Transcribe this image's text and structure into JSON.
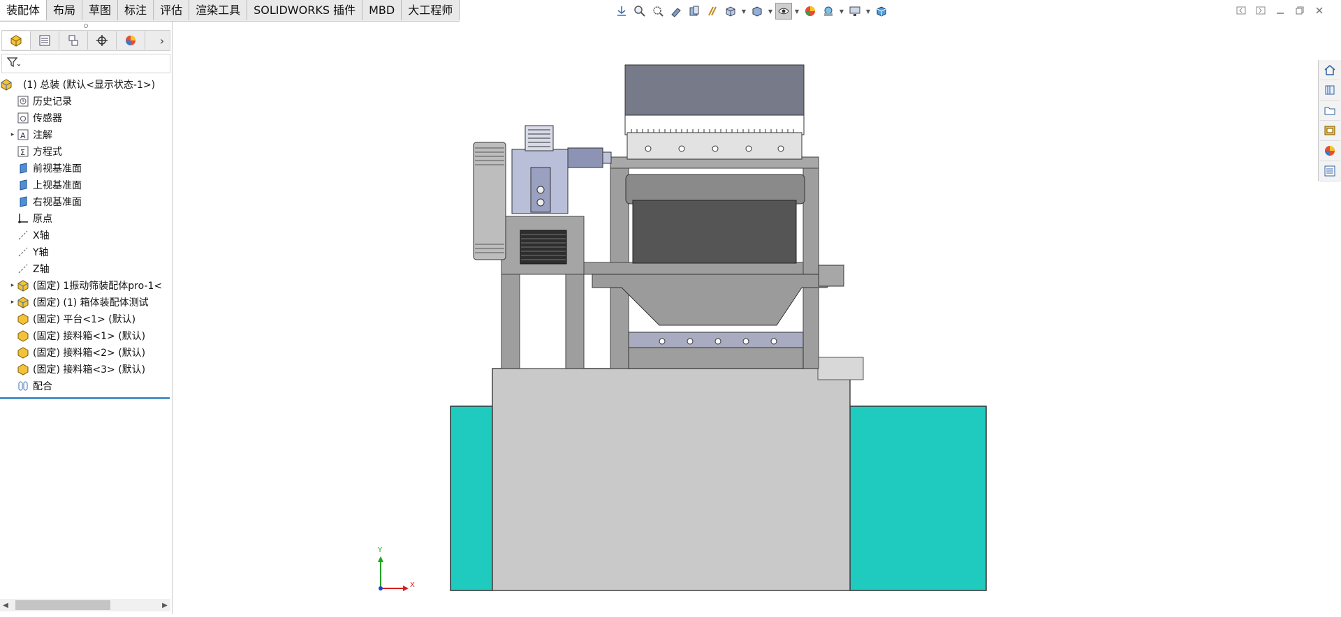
{
  "command_tabs": [
    {
      "label": "装配体",
      "active": true
    },
    {
      "label": "布局"
    },
    {
      "label": "草图"
    },
    {
      "label": "标注"
    },
    {
      "label": "评估"
    },
    {
      "label": "渲染工具"
    },
    {
      "label": "SOLIDWORKS 插件"
    },
    {
      "label": "MBD"
    },
    {
      "label": "大工程师"
    }
  ],
  "hud_tools": [
    "view-orientation-icon",
    "zoom-to-fit-icon",
    "zoom-to-area-icon",
    "previous-view-icon",
    "section-view-icon",
    "dynamic-annotation-icon",
    "view-orientation-icon",
    "display-style-icon",
    "hide-show-items-icon",
    "edit-appearance-icon",
    "apply-scene-icon",
    "view-settings-icon",
    "view-cube-icon"
  ],
  "feature_tree": {
    "root": "(1) 总装 (默认<显示状态-1>)",
    "items": [
      {
        "label": "历史记录",
        "icon": "history-icon"
      },
      {
        "label": "传感器",
        "icon": "sensor-icon"
      },
      {
        "label": "注解",
        "icon": "annotation-icon",
        "expandable": true
      },
      {
        "label": "方程式",
        "icon": "equation-icon"
      },
      {
        "label": "前视基准面",
        "icon": "plane-icon"
      },
      {
        "label": "上视基准面",
        "icon": "plane-icon"
      },
      {
        "label": "右视基准面",
        "icon": "plane-icon"
      },
      {
        "label": "原点",
        "icon": "origin-icon"
      },
      {
        "label": "X轴",
        "icon": "axis-icon"
      },
      {
        "label": "Y轴",
        "icon": "axis-icon"
      },
      {
        "label": "Z轴",
        "icon": "axis-icon"
      },
      {
        "label": "(固定) 1振动筛装配体pro-1<",
        "icon": "subassembly-icon",
        "expandable": true
      },
      {
        "label": "(固定) (1) 箱体装配体测试",
        "icon": "subassembly-icon",
        "expandable": true
      },
      {
        "label": "(固定) 平台<1> (默认)",
        "icon": "part-icon"
      },
      {
        "label": "(固定) 接料箱<1> (默认)",
        "icon": "part-icon"
      },
      {
        "label": "(固定) 接料箱<2> (默认)",
        "icon": "part-icon"
      },
      {
        "label": "(固定) 接料箱<3> (默认)",
        "icon": "part-icon"
      },
      {
        "label": "配合",
        "icon": "mate-icon"
      }
    ]
  },
  "triad": {
    "x_label": "X",
    "y_label": "Y"
  },
  "colors": {
    "accent": "#4a90c8",
    "bin_teal": "#1ecbbe",
    "platform_gray": "#c9c9c9",
    "frame_gray": "#9e9e9e"
  }
}
